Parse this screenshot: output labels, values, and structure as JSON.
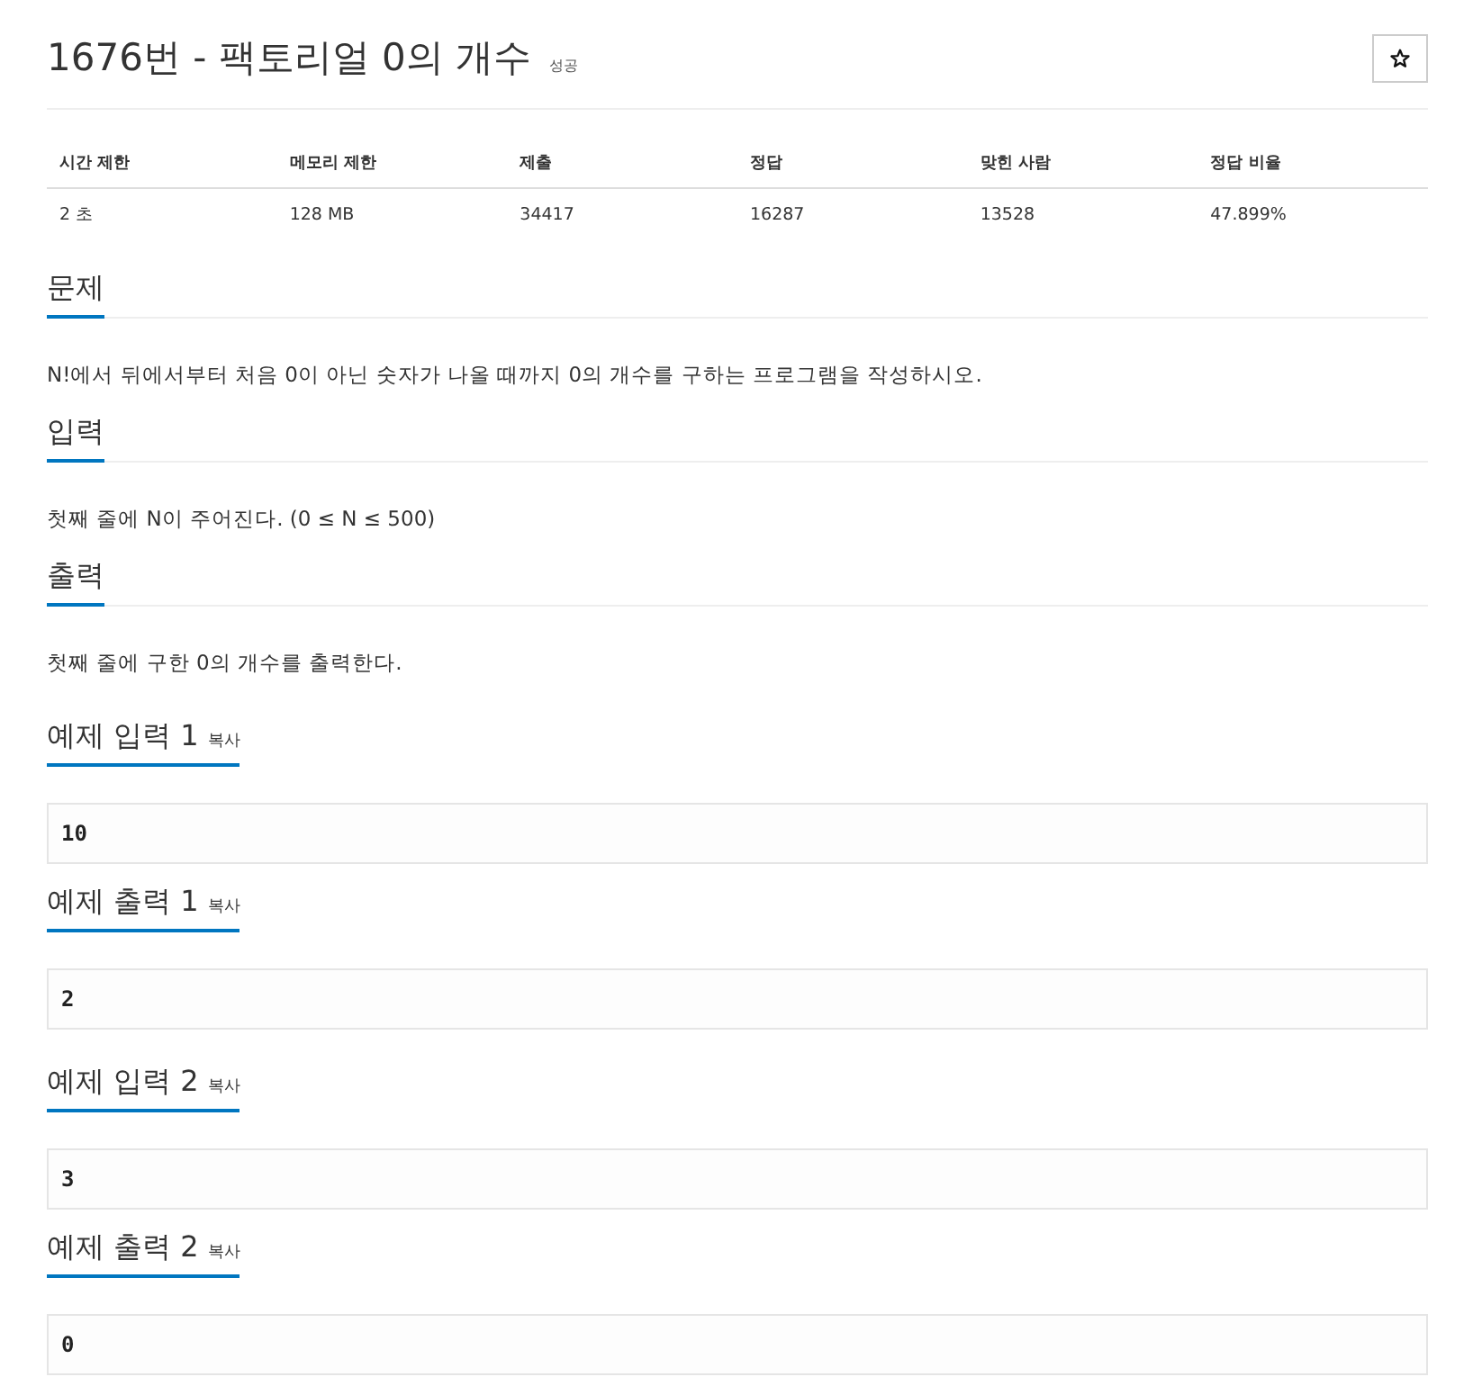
{
  "header": {
    "title": "1676번 - 팩토리얼 0의 개수",
    "result": "성공"
  },
  "stats_table": {
    "columns": [
      "시간 제한",
      "메모리 제한",
      "제출",
      "정답",
      "맞힌 사람",
      "정답 비율"
    ],
    "rows": [
      [
        "2 초",
        "128 MB",
        "34417",
        "16287",
        "13528",
        "47.899%"
      ]
    ]
  },
  "sections": [
    {
      "heading": "문제",
      "body": "N!에서 뒤에서부터 처음 0이 아닌 숫자가 나올 때까지 0의 개수를 구하는 프로그램을 작성하시오."
    },
    {
      "heading": "입력",
      "body": "첫째 줄에 N이 주어진다. (0 ≤ N ≤ 500)"
    },
    {
      "heading": "출력",
      "body": "첫째 줄에 구한 0의 개수를 출력한다."
    }
  ],
  "sample_pairs": [
    {
      "input": {
        "heading": "예제 입력 1",
        "copy_link": "복사",
        "data": "10"
      },
      "output": {
        "heading": "예제 출력 1",
        "copy_link": "복사",
        "data": "2"
      }
    },
    {
      "input": {
        "heading": "예제 입력 2",
        "copy_link": "복사",
        "data": "3"
      },
      "output": {
        "heading": "예제 출력 2",
        "copy_link": "복사",
        "data": "0"
      }
    }
  ]
}
